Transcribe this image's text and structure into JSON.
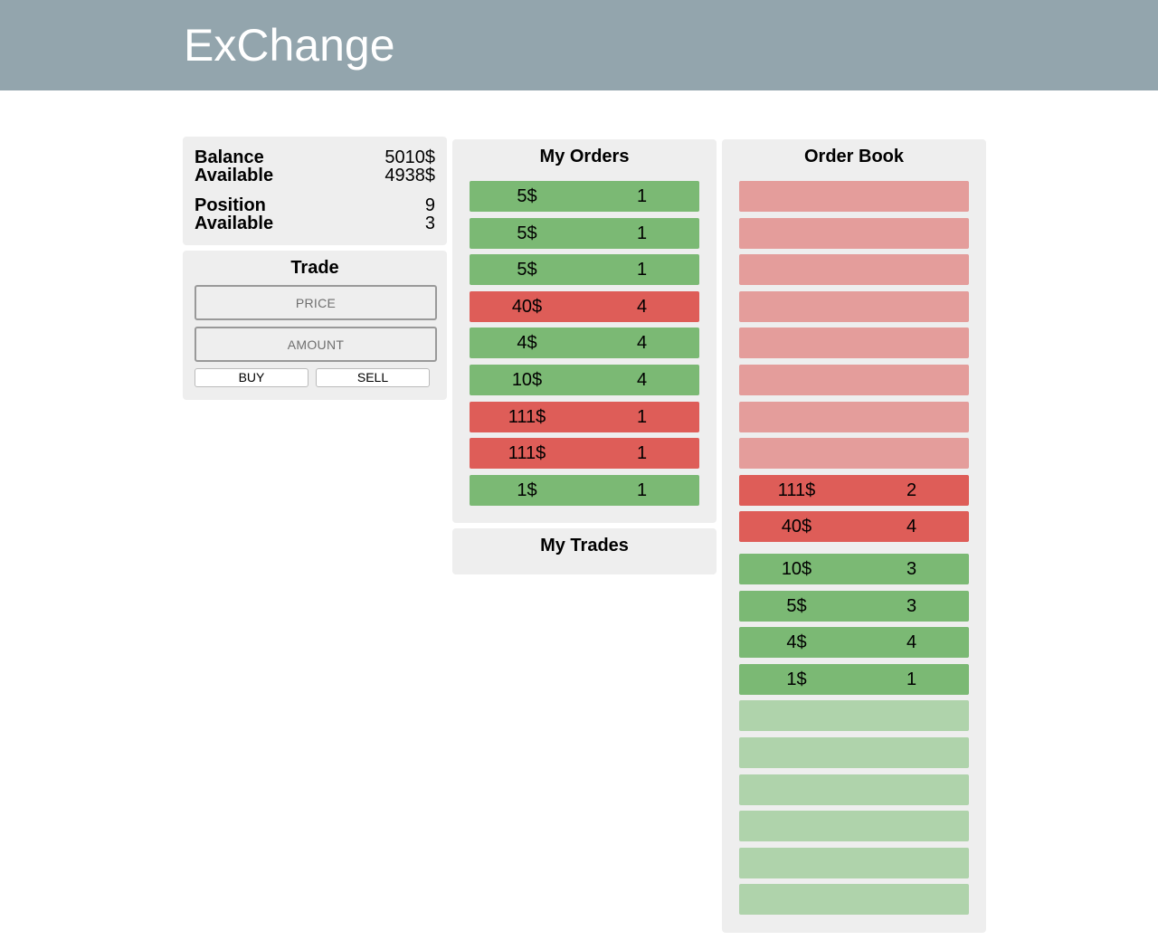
{
  "app": {
    "title": "ExChange"
  },
  "account": {
    "balance_label": "Balance",
    "balance_value": "5010$",
    "balance_available_label": "Available",
    "balance_available_value": "4938$",
    "position_label": "Position",
    "position_value": "9",
    "position_available_label": "Available",
    "position_available_value": "3"
  },
  "trade": {
    "title": "Trade",
    "price_placeholder": "PRICE",
    "amount_placeholder": "AMOUNT",
    "buy_label": "BUY",
    "sell_label": "SELL"
  },
  "my_orders": {
    "title": "My Orders",
    "rows": [
      {
        "side": "buy",
        "price": "5$",
        "qty": "1"
      },
      {
        "side": "buy",
        "price": "5$",
        "qty": "1"
      },
      {
        "side": "buy",
        "price": "5$",
        "qty": "1"
      },
      {
        "side": "sell",
        "price": "40$",
        "qty": "4"
      },
      {
        "side": "buy",
        "price": "4$",
        "qty": "4"
      },
      {
        "side": "buy",
        "price": "10$",
        "qty": "4"
      },
      {
        "side": "sell",
        "price": "111$",
        "qty": "1"
      },
      {
        "side": "sell",
        "price": "111$",
        "qty": "1"
      },
      {
        "side": "buy",
        "price": "1$",
        "qty": "1"
      }
    ]
  },
  "my_trades": {
    "title": "My Trades"
  },
  "order_book": {
    "title": "Order Book",
    "empty_ask_levels": 8,
    "asks": [
      {
        "price": "111$",
        "qty": "2"
      },
      {
        "price": "40$",
        "qty": "4"
      }
    ],
    "bids": [
      {
        "price": "10$",
        "qty": "3"
      },
      {
        "price": "5$",
        "qty": "3"
      },
      {
        "price": "4$",
        "qty": "4"
      },
      {
        "price": "1$",
        "qty": "1"
      }
    ],
    "empty_bid_levels": 6
  },
  "colors": {
    "header": "#93a5ad",
    "panel": "#eeeeee",
    "buy": "#7bb974",
    "sell": "#de5d58",
    "sell_empty": "#e49d9b",
    "buy_empty": "#afd3ab"
  }
}
